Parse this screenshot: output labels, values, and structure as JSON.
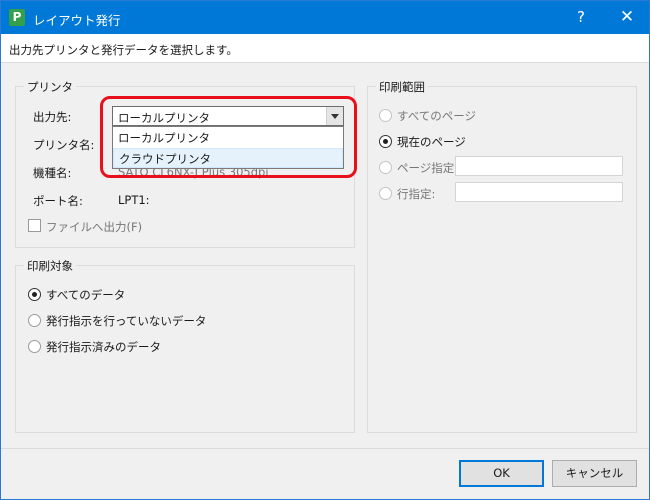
{
  "window": {
    "app_icon_letter": "P",
    "title": "レイアウト発行",
    "help_label": "?",
    "close_label": "✕"
  },
  "instruction": "出力先プリンタと発行データを選択します。",
  "printer_group": {
    "title": "プリンタ",
    "output_label": "出力先:",
    "output_value": "ローカルプリンタ",
    "dropdown_options": [
      "ローカルプリンタ",
      "クラウドプリンタ"
    ],
    "printer_name_label": "プリンタ名:",
    "model_label": "機種名:",
    "model_value": "SATO CL6NX-J Plus 305dpi",
    "port_label": "ポート名:",
    "port_value": "LPT1:",
    "file_output_label": "ファイルへ出力(F)"
  },
  "print_target_group": {
    "title": "印刷対象",
    "options": [
      "すべてのデータ",
      "発行指示を行っていないデータ",
      "発行指示済みのデータ"
    ],
    "selected": "すべてのデータ"
  },
  "print_range_group": {
    "title": "印刷範囲",
    "options": [
      "すべてのページ",
      "現在のページ",
      "ページ指定:",
      "行指定:"
    ],
    "selected": "現在のページ"
  },
  "footer": {
    "ok_label": "OK",
    "cancel_label": "キャンセル"
  },
  "colors": {
    "title_bar": "#0078d7",
    "highlight": "#e8101a",
    "app_icon": "#33a04a"
  }
}
